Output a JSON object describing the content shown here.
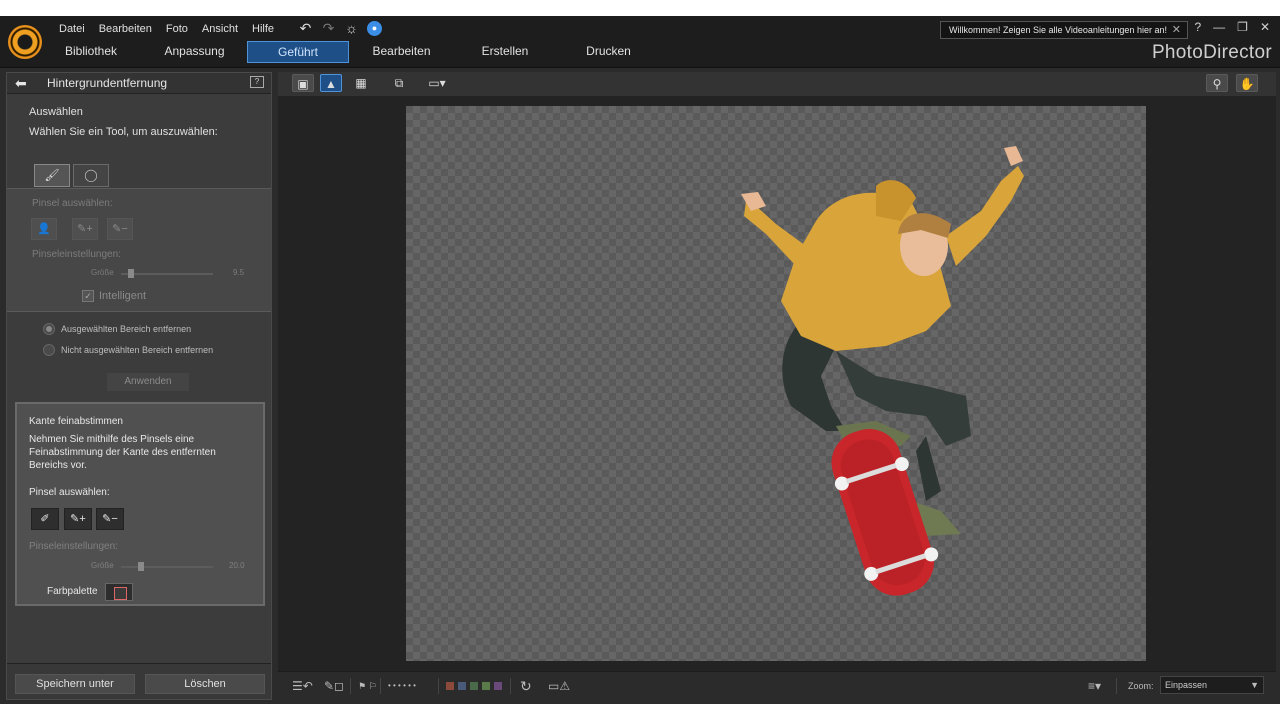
{
  "app": {
    "brand": "PhotoDirector"
  },
  "menu": [
    "Datei",
    "Bearbeiten",
    "Foto",
    "Ansicht",
    "Hilfe"
  ],
  "quick_actions": {
    "undo": "↶",
    "redo": "↷",
    "settings": "☼",
    "notify": "🔔"
  },
  "welcome_banner": {
    "text": "Willkommen! Zeigen Sie alle Videoanleitungen hier an!",
    "close": "✕"
  },
  "window_controls": {
    "help": "?",
    "minimize": "—",
    "restore": "❐",
    "close": "✕"
  },
  "tabs": [
    {
      "label": "Bibliothek",
      "active": false
    },
    {
      "label": "Anpassung",
      "active": false
    },
    {
      "label": "Geführt",
      "active": true
    },
    {
      "label": "Bearbeiten",
      "active": false
    },
    {
      "label": "Erstellen",
      "active": false
    },
    {
      "label": "Drucken",
      "active": false
    }
  ],
  "panel": {
    "title": "Hintergrundentfernung",
    "help": "?",
    "select_heading": "Auswählen",
    "select_hint": "Wählen Sie ein Tool, um auszuwählen:",
    "brush_select_label": "Pinsel auswählen:",
    "brush_settings_label": "Pinseleinstellungen:",
    "size_label": "Größe",
    "size_value": "9.5",
    "size_level": 0.08,
    "intelligent_label": "Intelligent",
    "intelligent_checked": true,
    "radio_remove_selected": "Ausgewählten Bereich entfernen",
    "radio_remove_unselected": "Nicht ausgewählten Bereich entfernen",
    "radio_selected_index": 0,
    "apply_button": "Anwenden",
    "refine": {
      "title": "Kante feinabstimmen",
      "description_1": "Nehmen Sie mithilfe des Pinsels eine",
      "description_2": "Feinabstimmung der Kante des entfernten",
      "description_3": "Bereichs vor.",
      "brush_select_label": "Pinsel auswählen:",
      "brush_settings_label": "Pinseleinstellungen:",
      "size_label": "Größe",
      "size_value": "20.0",
      "size_level": 0.2,
      "palette_label": "Farbpalette"
    },
    "save_button": "Speichern unter",
    "delete_button": "Löschen"
  },
  "bottom": {
    "zoom_label": "Zoom:",
    "zoom_value": "Einpassen",
    "dots": "• • • • • •"
  },
  "colors": {
    "accent": "#1f4f87",
    "accent_border": "#4f93da",
    "label_colors": [
      "#8b4a3a",
      "#4a5a7a",
      "#4a6a4a",
      "#5a7a4a",
      "#6a4a7a"
    ]
  },
  "canvas_image": {
    "subject": "skateboarder-cutout"
  }
}
